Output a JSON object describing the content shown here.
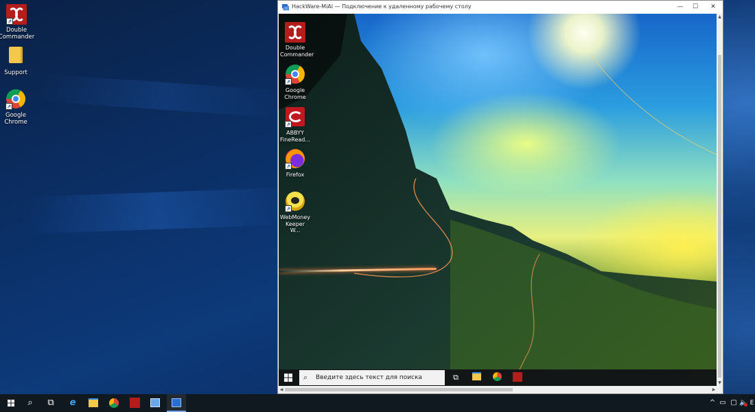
{
  "desktop": {
    "icons": [
      {
        "label_line1": "Double",
        "label_line2": "Commander",
        "icon": "double-commander-icon"
      },
      {
        "label_line1": "Support",
        "label_line2": "",
        "icon": "folder-icon"
      },
      {
        "label_line1": "Google",
        "label_line2": "Chrome",
        "icon": "chrome-icon"
      }
    ]
  },
  "rdp_window": {
    "title": "HackWare-MiAl — Подключение к удаленному рабочему столу",
    "minimize_glyph": "—",
    "maximize_glyph": "☐",
    "close_glyph": "✕",
    "remote_desktop": {
      "icons": [
        {
          "label_line1": "Double",
          "label_line2": "Commander",
          "icon": "double-commander-icon"
        },
        {
          "label_line1": "Google",
          "label_line2": "Chrome",
          "icon": "chrome-icon"
        },
        {
          "label_line1": "ABBYY",
          "label_line2": "FineRead...",
          "icon": "abbyy-finereader-icon"
        },
        {
          "label_line1": "Firefox",
          "label_line2": "",
          "icon": "firefox-icon"
        },
        {
          "label_line1": "WebMoney",
          "label_line2": "Keeper W...",
          "icon": "webmoney-icon"
        }
      ],
      "taskbar": {
        "search_placeholder": "Введите здесь текст для поиска"
      }
    }
  },
  "taskbar": {
    "tray_language": "E"
  },
  "colors": {
    "taskbar_bg": "#101820",
    "accent": "#78a9e6"
  }
}
